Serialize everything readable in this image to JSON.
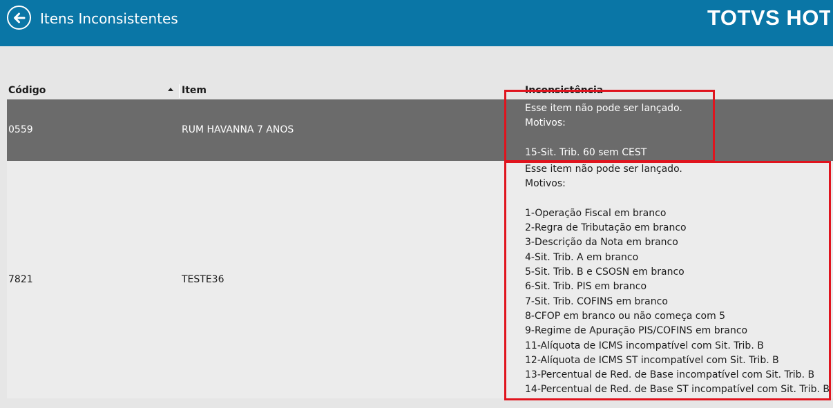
{
  "header": {
    "title": "Itens Inconsistentes",
    "brand": "TOTVS HOTÉIS",
    "accent_color": "#0a76a6",
    "back_icon": "arrow-left-circle-icon"
  },
  "table": {
    "columns": [
      {
        "label": "Código",
        "sort": "ascending"
      },
      {
        "label": "Item"
      },
      {
        "label": "Inconsistência"
      }
    ],
    "rows": [
      {
        "codigo": "0559",
        "item": "RUM HAVANNA 7 ANOS",
        "selected": true,
        "inconsistencia": "Esse item não pode ser lançado.\nMotivos:\n\n15-Sit. Trib. 60 sem CEST"
      },
      {
        "codigo": "7821",
        "item": "TESTE36",
        "selected": false,
        "inconsistencia": "Esse item não pode ser lançado.\nMotivos:\n\n1-Operação Fiscal em branco\n2-Regra de Tributação em branco\n3-Descrição da Nota em branco\n4-Sit. Trib. A em branco\n5-Sit. Trib. B e CSOSN em branco\n6-Sit. Trib. PIS em branco\n7-Sit. Trib. COFINS em branco\n8-CFOP em branco ou não começa com 5\n9-Regime de Apuração PIS/COFINS em branco\n11-Alíquota de ICMS incompatível com Sit. Trib. B\n12-Alíquota de ICMS ST incompatível com Sit. Trib. B\n13-Percentual de Red. de Base incompatível com Sit. Trib. B\n14-Percentual de Red. de Base ST incompatível com Sit. Trib. B"
      }
    ]
  },
  "annotations": {
    "highlight_color": "#e0141e"
  }
}
